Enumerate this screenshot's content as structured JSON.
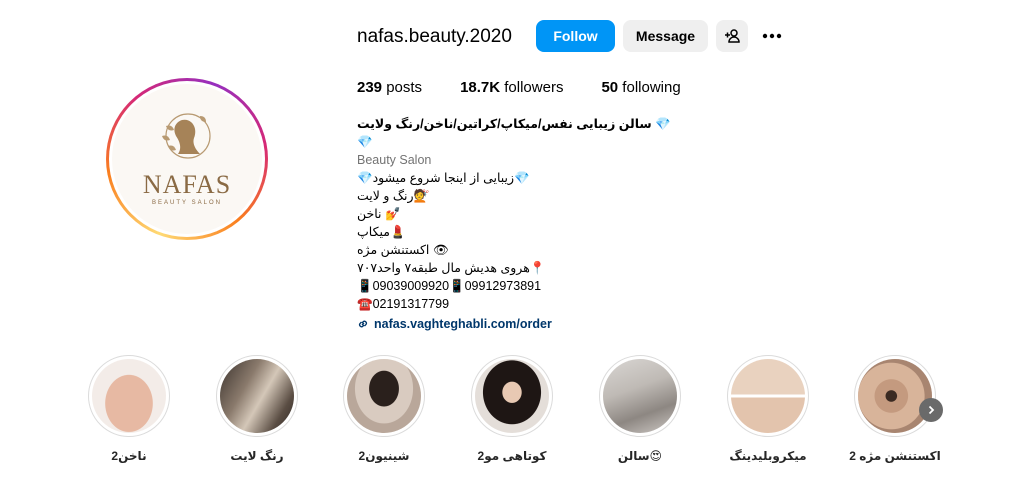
{
  "profile": {
    "username": "nafas.beauty.2020",
    "logo_text": "NAFAS",
    "logo_subtext": "BEAUTY SALON"
  },
  "actions": {
    "follow_label": "Follow",
    "message_label": "Message"
  },
  "stats": {
    "posts_count": "239",
    "posts_label": " posts",
    "followers_count": "18.7K",
    "followers_label": " followers",
    "following_count": "50",
    "following_label": " following"
  },
  "bio": {
    "name": "💎 سالن زیبایی نفس/میکاپ/کراتین/ناخن/رنگ ولایت 💎",
    "category": "Beauty Salon",
    "lines": [
      "💎زیبایی از اینجا شروع میشود💎",
      "💇رنگ و لایت",
      "💅 ناخن",
      "💄میکاپ",
      "👁 اکستنشن مژه",
      "📍هروی هدیش مال طبقه۷ واحد۷۰۷",
      "📱09039009920📱09912973891",
      "☎️02191317799"
    ],
    "link": "nafas.vaghteghabli.com/order"
  },
  "highlights": [
    {
      "label": "اکستنشن مژه 2"
    },
    {
      "label": "میکروبلیدینگ"
    },
    {
      "label": "سالن😍"
    },
    {
      "label": "کوتاهی مو2"
    },
    {
      "label": "شینیون2"
    },
    {
      "label": "رنگ لایت"
    },
    {
      "label": "ناخن2"
    }
  ],
  "colors": {
    "follow_button": "#0095f6",
    "secondary_button": "#efefef",
    "link": "#00376b"
  }
}
